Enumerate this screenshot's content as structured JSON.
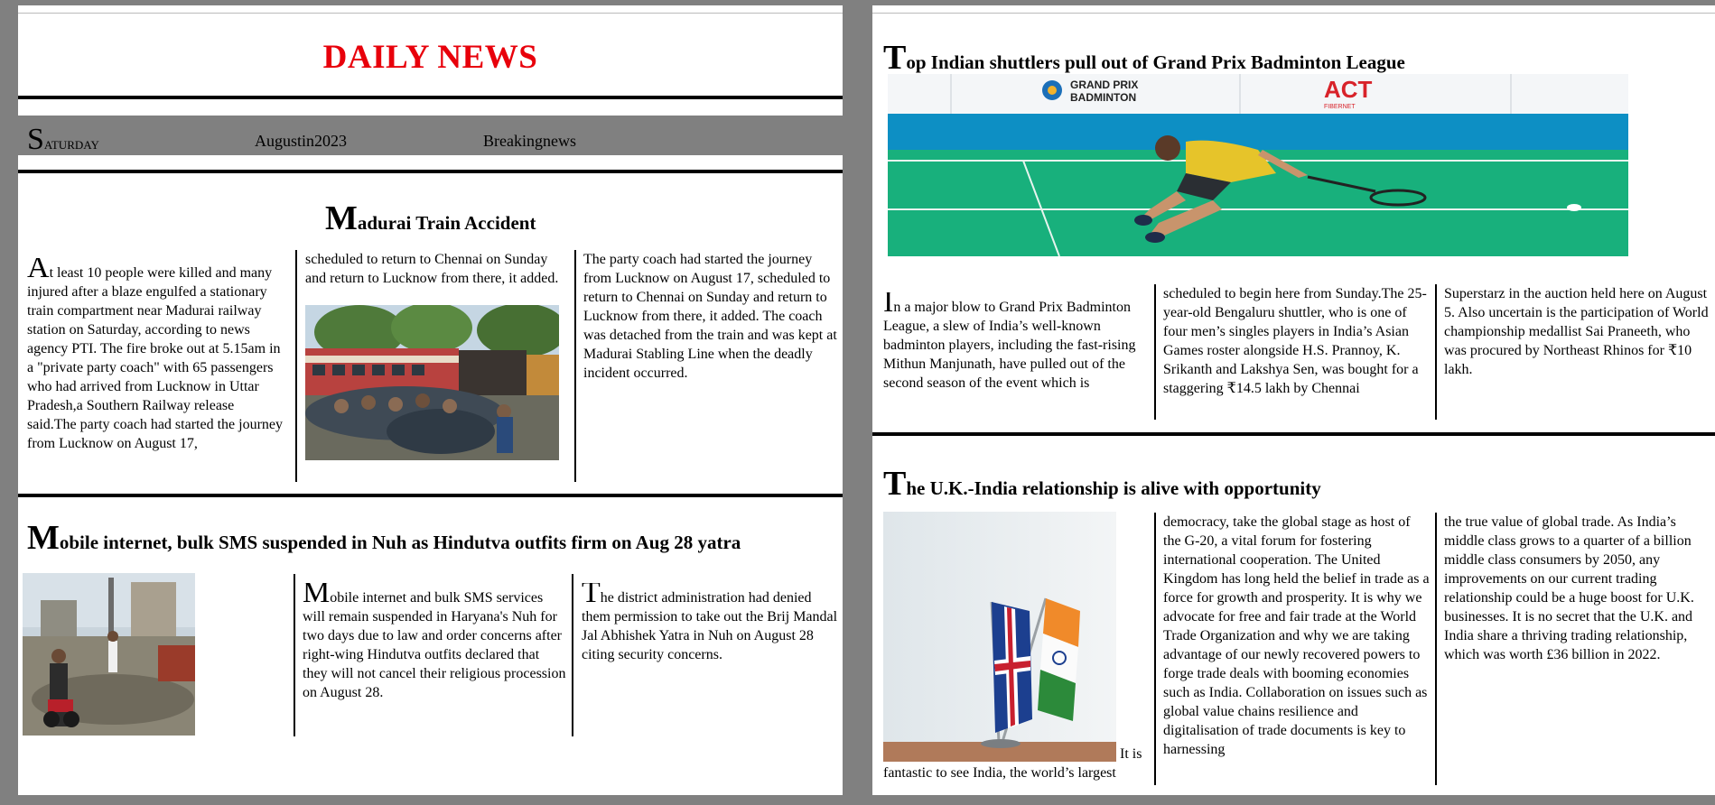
{
  "masthead": {
    "title": "DAILY NEWS"
  },
  "dateline": {
    "day": "Saturday",
    "date": "Augustin2023",
    "label": "Breakingnews"
  },
  "left": {
    "article1": {
      "headline": "Madurai Train Accident",
      "col1": "At least 10 people were killed and many injured after a blaze engulfed a stationary train compartment near Madurai railway station on Saturday, according to news agency PTI. The fire broke out at 5.15am in a \"private party coach\" with 65 passengers who had arrived from Lucknow in Uttar Pradesh,a Southern Railway release said.The party coach had started the journey from Lucknow on August 17,",
      "col2": "scheduled to return to Chennai on Sunday and return to Lucknow from there, it added.",
      "col3": "The party coach had started the journey from Lucknow on August 17, scheduled to return to Chennai on Sunday and return to Lucknow from there, it added. The coach was detached from the train and was kept at Madurai Stabling Line when the deadly incident occurred."
    },
    "article2": {
      "headline": "Mobile internet, bulk SMS suspended in Nuh as Hindutva outfits firm on Aug 28 yatra",
      "col2": "Mobile internet and bulk SMS services will remain suspended in Haryana's Nuh for two days due to law and order concerns after right-wing Hindutva outfits declared that they will not cancel their religious procession on August 28.",
      "col3": "The district administration had denied them permission to take out the Brij Mandal Jal Abhishek Yatra in Nuh on August 28 citing security concerns."
    }
  },
  "right": {
    "article1": {
      "headline": "Top Indian shuttlers pull out of Grand Prix Badminton League",
      "banner_left": "GRAND PRIX",
      "banner_left2": "BADMINTON",
      "banner_mid": "ACT",
      "banner_mid2": "FIBERNET",
      "col1": "In a major blow to Grand Prix Badminton League, a slew of India’s well-known badminton players, including the fast-rising Mithun Manjunath, have pulled out of the second season of the event which is",
      "col2": "scheduled to begin here from Sunday.The 25-year-old Bengaluru shuttler, who is one of four men’s singles players in India’s Asian Games roster alongside H.S. Prannoy, K. Srikanth and Lakshya Sen, was bought for a staggering ₹14.5 lakh by Chennai",
      "col3": "Superstarz in the auction held here on August 5. Also uncertain is the participation of World championship medallist Sai Praneeth, who was procured by Northeast Rhinos for ₹10 lakh."
    },
    "article2": {
      "headline": "The U.K.-India relationship is alive with opportunity",
      "col1_tail": "It is fantastic to see India, the world’s largest",
      "col2": "democracy, take the global stage as host of the G-20, a vital forum for fostering international cooperation. The United Kingdom has long held the belief in trade as a force for growth and prosperity. It is why we advocate for free and fair trade at the World Trade Organization and why we are taking advantage of our newly recovered powers to forge trade deals with booming economies such as India. Collaboration on issues such as global value chains resilience and digitalisation of trade documents is key to harnessing",
      "col3": "the true value of global trade. As India’s middle class grows to a quarter of a billion middle class consumers by 2050, any improvements on our current trading relationship could be a huge boost for U.K. businesses. It is no secret that the U.K. and India share a thriving trading relationship, which was worth £36 billion in 2022."
    }
  },
  "colors": {
    "masthead": "#e8000b",
    "background": "#808080"
  }
}
